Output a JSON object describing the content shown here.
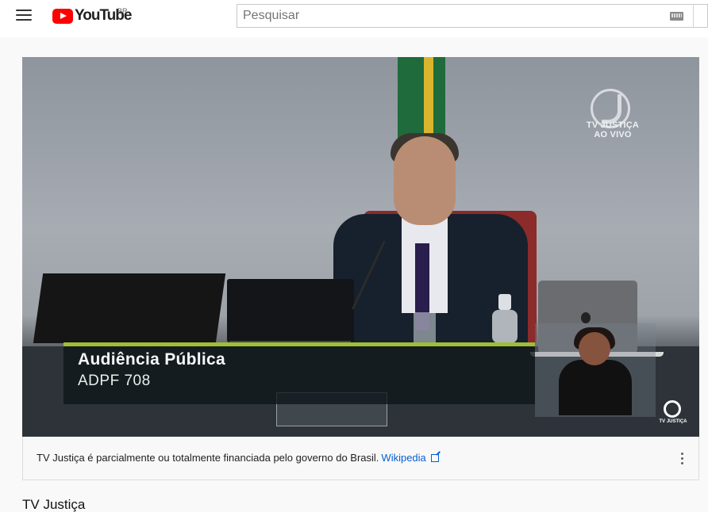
{
  "header": {
    "logo_text": "YouTube",
    "region": "BR",
    "search_placeholder": "Pesquisar"
  },
  "player": {
    "watermark_top": "TV JUSTIÇA",
    "watermark_live": "AO VIVO",
    "lower_third_title": "Audiência Pública",
    "lower_third_subtitle": "ADPF 708",
    "corner_logo_label": "TV JUSTIÇA"
  },
  "info_panel": {
    "message": "TV Justiça é parcialmente ou totalmente financiada pelo governo do Brasil.",
    "link_text": "Wikipedia",
    "menu_icon": "more-vertical-icon"
  },
  "channel": {
    "title": "TV Justiça"
  },
  "colors": {
    "brand": "#ff0000",
    "link": "#065fd4",
    "lower_third_accent": "#9fbe35"
  }
}
